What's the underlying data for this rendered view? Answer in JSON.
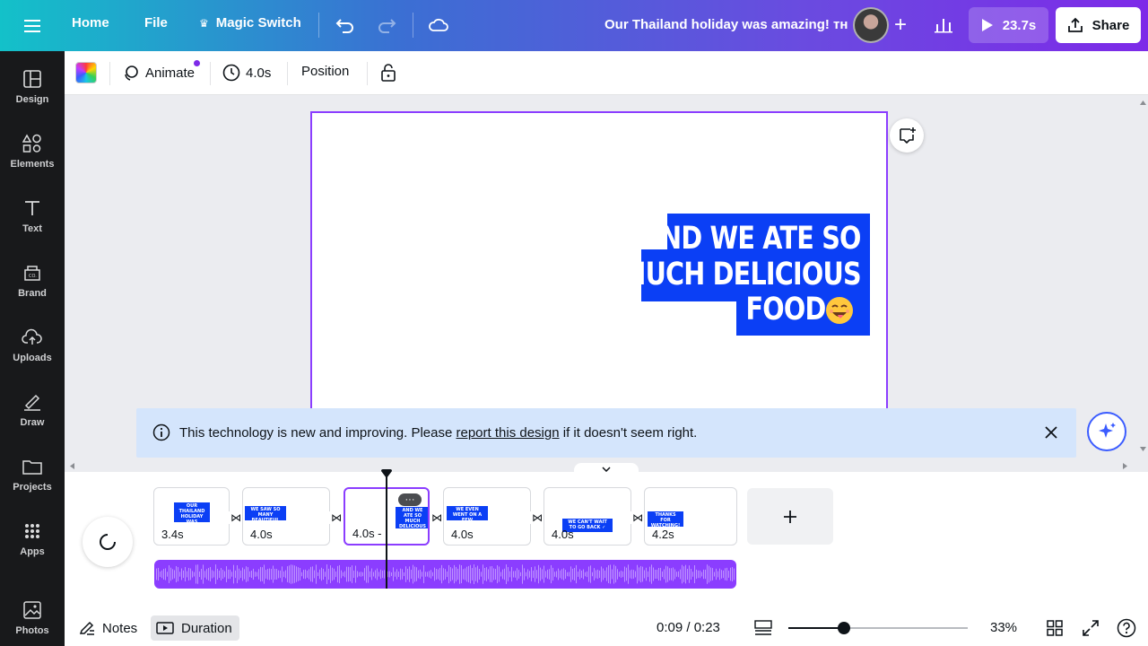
{
  "topbar": {
    "home": "Home",
    "file": "File",
    "magic_switch": "Magic Switch",
    "doc_title": "Our Thailand holiday was amazing! ᴛʜ",
    "play_duration": "23.7s",
    "share": "Share"
  },
  "sidebar": {
    "items": [
      {
        "label": "Design",
        "icon": "layout-icon"
      },
      {
        "label": "Elements",
        "icon": "shapes-icon"
      },
      {
        "label": "Text",
        "icon": "text-icon"
      },
      {
        "label": "Brand",
        "icon": "brand-icon"
      },
      {
        "label": "Uploads",
        "icon": "cloud-upload-icon"
      },
      {
        "label": "Draw",
        "icon": "pen-icon"
      },
      {
        "label": "Projects",
        "icon": "folder-icon"
      },
      {
        "label": "Apps",
        "icon": "grid-icon"
      },
      {
        "label": "Photos",
        "icon": "image-icon"
      }
    ]
  },
  "toolbar": {
    "animate": "Animate",
    "duration": "4.0s",
    "position": "Position"
  },
  "canvas": {
    "headline": [
      "AND WE ATE SO",
      "MUCH DELICIOUS",
      "FOOD"
    ],
    "accent_color": "#0b3ff5",
    "selection_color": "#8b3dff"
  },
  "notice": {
    "prefix": "This technology is new and improving. Please ",
    "link": "report this design",
    "suffix": " if it doesn't seem right."
  },
  "timeline": {
    "scenes": [
      {
        "duration": "3.4s",
        "thumb": "OUR THAILAND HOLIDAY WAS AMAZING ᴛʜ"
      },
      {
        "duration": "4.0s",
        "thumb": "WE SAW SO MANY BEAUTIFUL PLACES"
      },
      {
        "duration": "4.0s -",
        "thumb": "AND WE ATE SO MUCH DELICIOUS FOOD"
      },
      {
        "duration": "4.0s",
        "thumb": "WE EVEN WENT ON A FEW ADVENTURES"
      },
      {
        "duration": "4.0s",
        "thumb": "WE CAN'T WAIT TO GO BACK ✓"
      },
      {
        "duration": "4.2s",
        "thumb": "THANKS FOR WATCHING!"
      }
    ],
    "more": "···"
  },
  "bottombar": {
    "notes": "Notes",
    "duration": "Duration",
    "time": "0:09 / 0:23",
    "zoom": "33%",
    "zoom_fraction": 0.31
  }
}
